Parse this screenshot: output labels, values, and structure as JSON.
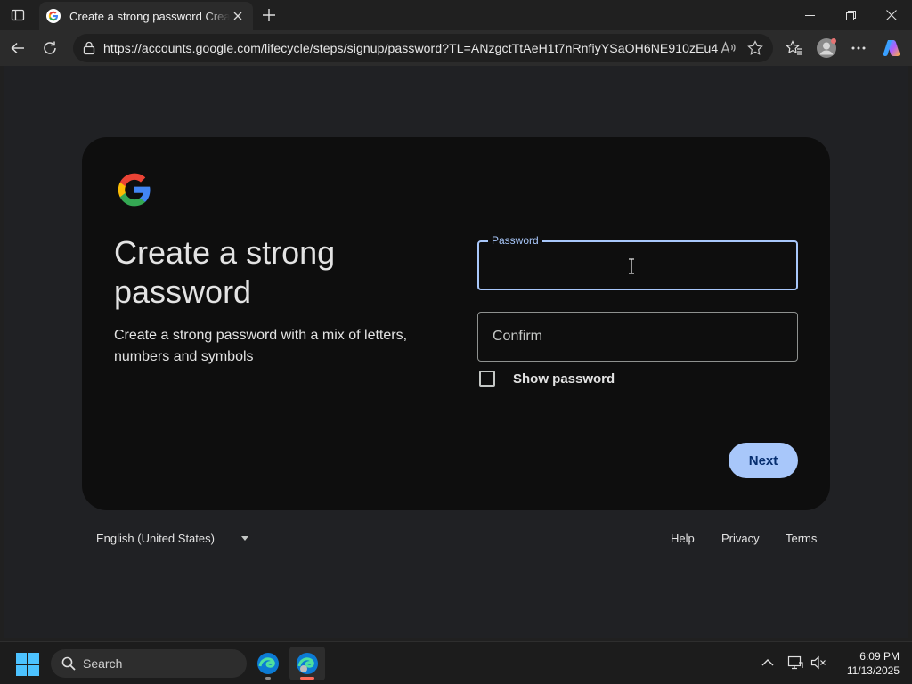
{
  "browser": {
    "tab": {
      "title": "Create a strong password Create a strong password"
    },
    "address": {
      "url": "https://accounts.google.com/lifecycle/steps/signup/password?TL=ANzgctTtAeH1t7nRnfiyYSaOH6NE910zEu4..."
    }
  },
  "signup": {
    "heading": "Create a strong password",
    "subtext": "Create a strong password with a mix of letters, numbers and symbols",
    "password_label": "Password",
    "password_value": "",
    "confirm_placeholder": "Confirm",
    "show_password_label": "Show password",
    "show_password_checked": false,
    "next_label": "Next"
  },
  "footer": {
    "language": "English (United States)",
    "help": "Help",
    "privacy": "Privacy",
    "terms": "Terms"
  },
  "taskbar": {
    "search_label": "Search",
    "time": "6:09 PM",
    "date": "11/13/2025"
  },
  "colors": {
    "accent": "#a8c7fa",
    "card": "#0e0e0e",
    "page": "#202124"
  }
}
